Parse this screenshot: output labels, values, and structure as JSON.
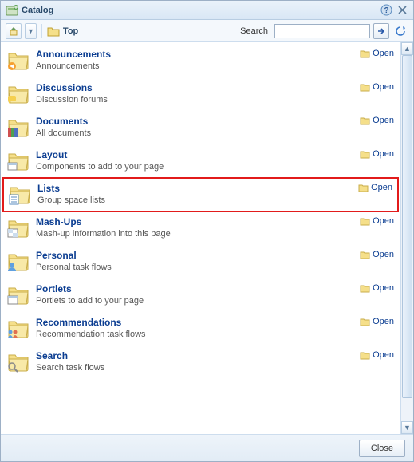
{
  "title": "Catalog",
  "toolbar": {
    "breadcrumb": "Top",
    "search_label": "Search",
    "search_value": ""
  },
  "open_label": "Open",
  "close_label": "Close",
  "items": [
    {
      "title": "Announcements",
      "desc": "Announcements",
      "overlay": "announce",
      "highlight": false
    },
    {
      "title": "Discussions",
      "desc": "Discussion forums",
      "overlay": "discuss",
      "highlight": false
    },
    {
      "title": "Documents",
      "desc": "All documents",
      "overlay": "docs",
      "highlight": false
    },
    {
      "title": "Layout",
      "desc": "Components to add to your page",
      "overlay": "layout",
      "highlight": false
    },
    {
      "title": "Lists",
      "desc": "Group space lists",
      "overlay": "lists",
      "highlight": true
    },
    {
      "title": "Mash-Ups",
      "desc": "Mash-up information into this page",
      "overlay": "mashup",
      "highlight": false
    },
    {
      "title": "Personal",
      "desc": "Personal task flows",
      "overlay": "personal",
      "highlight": false
    },
    {
      "title": "Portlets",
      "desc": "Portlets to add to your page",
      "overlay": "portlets",
      "highlight": false
    },
    {
      "title": "Recommendations",
      "desc": "Recommendation task flows",
      "overlay": "recs",
      "highlight": false
    },
    {
      "title": "Search",
      "desc": "Search task flows",
      "overlay": "search",
      "highlight": false
    }
  ]
}
